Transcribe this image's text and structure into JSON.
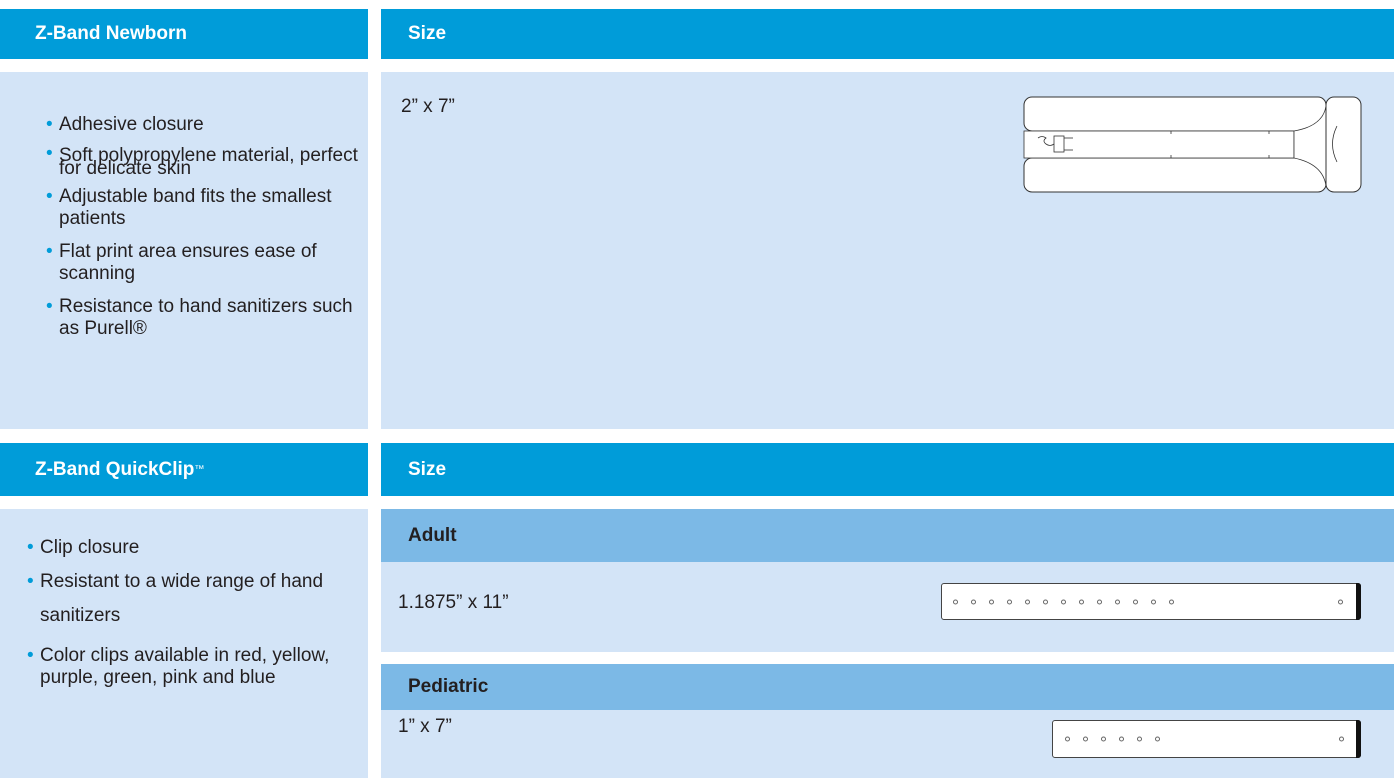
{
  "section1": {
    "title": "Z-Band Newborn",
    "size_header": "Size",
    "features": [
      "Adhesive closure",
      "Soft polypropylene material, perfect for delicate skin",
      "Adjustable band fits the smallest patients",
      "Flat print area ensures ease of scanning",
      "Resistance to hand sanitizers such as Purell®"
    ],
    "size_value": "2” x 7”"
  },
  "section2": {
    "title": "Z-Band QuickClip",
    "title_tm": "™",
    "size_header": "Size",
    "features": [
      "Clip closure",
      "Resistant to a wide range of hand sanitizers",
      "Color clips available in red, yellow, purple, green, pink and blue"
    ],
    "adult": {
      "label": "Adult",
      "size": "1.1875” x 11”"
    },
    "pediatric": {
      "label": "Pediatric",
      "size": "1” x 7”"
    }
  },
  "colors": {
    "header_blue": "#009cd9",
    "panel_blue": "#d3e4f7",
    "subheader_blue": "#7cb9e6"
  }
}
